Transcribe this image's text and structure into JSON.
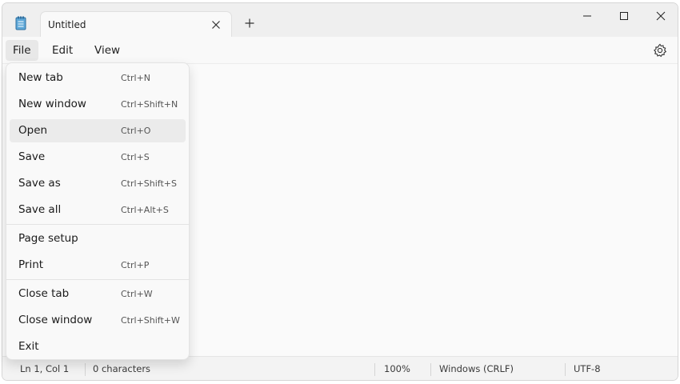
{
  "tab": {
    "title": "Untitled"
  },
  "menubar": {
    "file": "File",
    "edit": "Edit",
    "view": "View"
  },
  "file_menu": {
    "items": [
      {
        "label": "New tab",
        "shortcut": "Ctrl+N"
      },
      {
        "label": "New window",
        "shortcut": "Ctrl+Shift+N"
      },
      {
        "label": "Open",
        "shortcut": "Ctrl+O"
      },
      {
        "label": "Save",
        "shortcut": "Ctrl+S"
      },
      {
        "label": "Save as",
        "shortcut": "Ctrl+Shift+S"
      },
      {
        "label": "Save all",
        "shortcut": "Ctrl+Alt+S"
      },
      {
        "label": "Page setup",
        "shortcut": ""
      },
      {
        "label": "Print",
        "shortcut": "Ctrl+P"
      },
      {
        "label": "Close tab",
        "shortcut": "Ctrl+W"
      },
      {
        "label": "Close window",
        "shortcut": "Ctrl+Shift+W"
      },
      {
        "label": "Exit",
        "shortcut": ""
      }
    ]
  },
  "status": {
    "position": "Ln 1, Col 1",
    "characters": "0 characters",
    "zoom": "100%",
    "line_ending": "Windows (CRLF)",
    "encoding": "UTF-8"
  },
  "icons": {
    "app": "notepad-icon",
    "tab_close": "close-icon",
    "new_tab": "plus-icon",
    "settings": "gear-icon"
  },
  "colors": {
    "hover": "#ebebeb",
    "titlebar": "#efefef"
  }
}
